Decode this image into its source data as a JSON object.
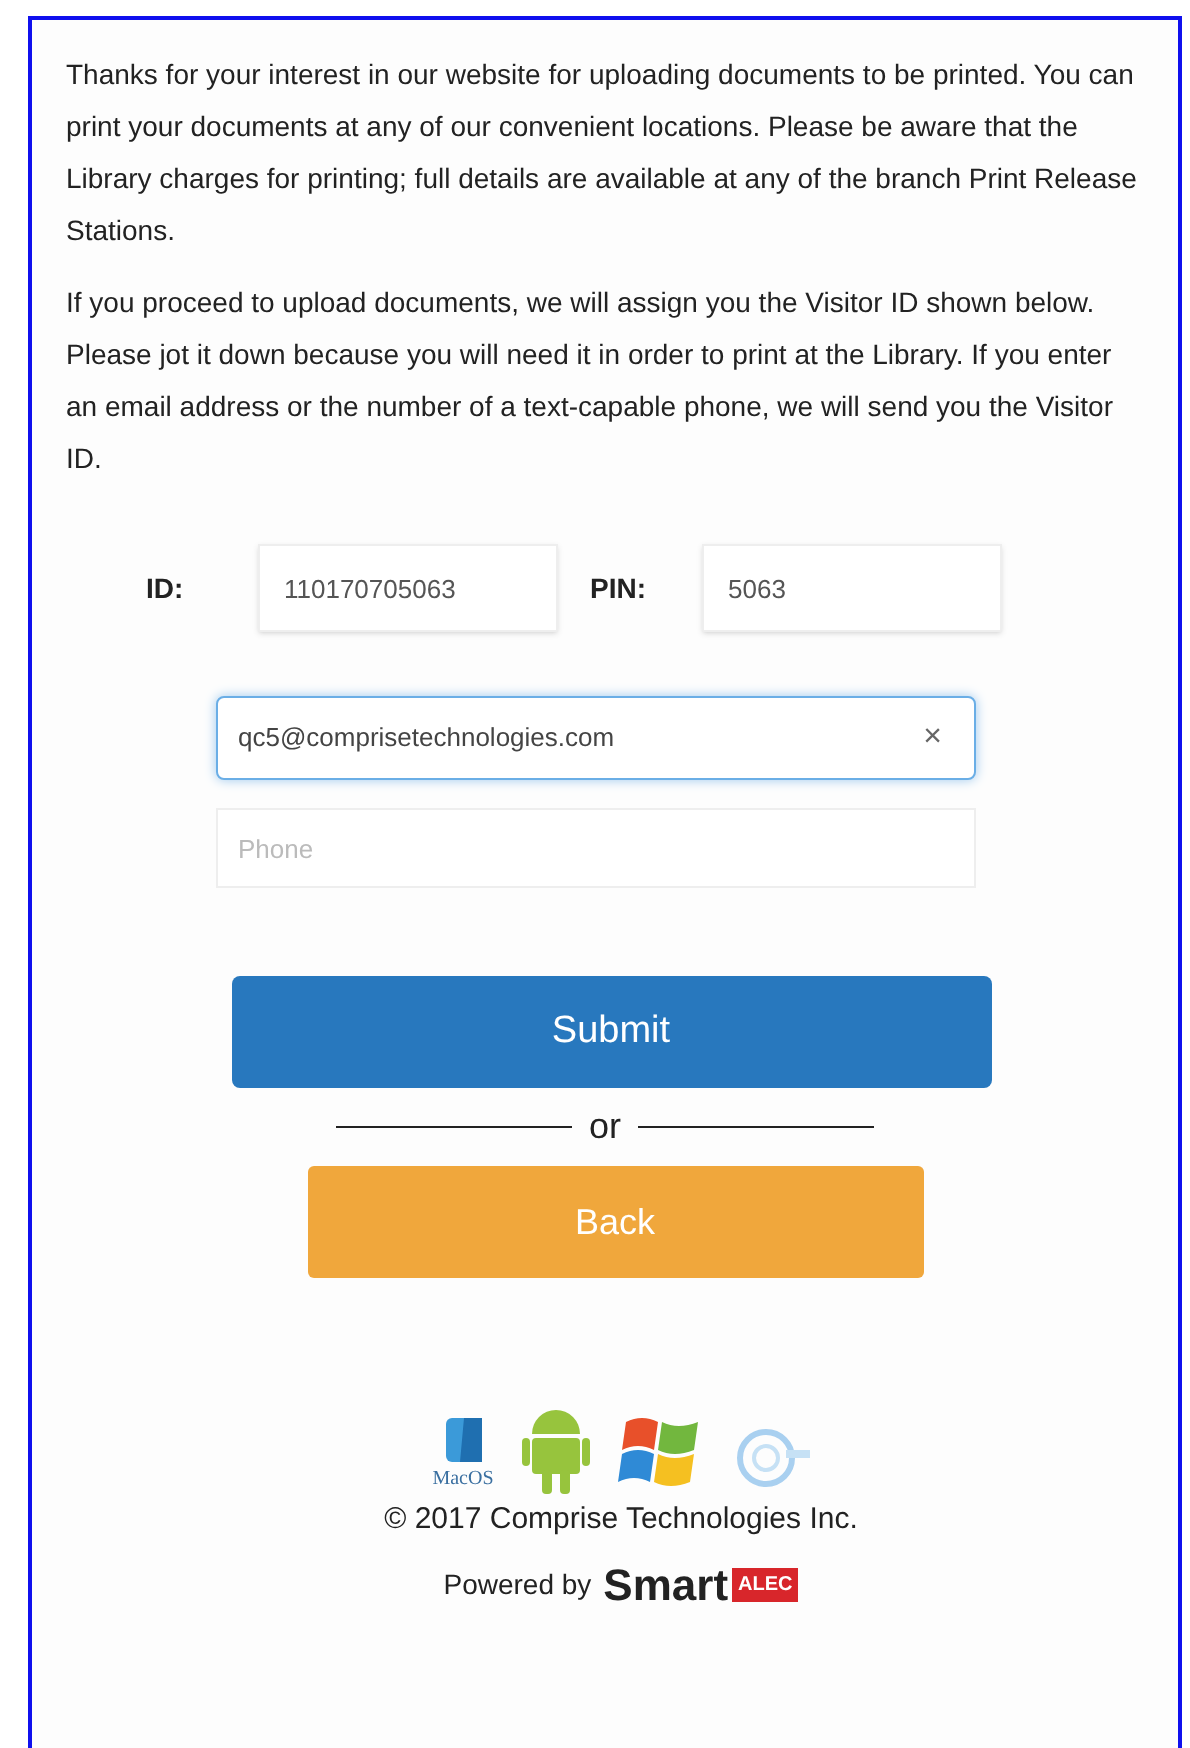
{
  "intro": [
    "Thanks for your interest in our website for uploading documents to be printed. You can print your documents at any of our convenient locations. Please be aware that the Library charges for printing; full details are available at any of the branch Print Release Stations.",
    "If you proceed to upload documents, we will assign you the Visitor ID shown below. Please jot it down because you will need it in order to print at the Library. If you enter an email address or the number of a text-capable phone, we will send you the Visitor ID."
  ],
  "credentials": [
    {
      "label": "ID:",
      "value": "110170705063"
    },
    {
      "label": "PIN:",
      "value": "5063"
    }
  ],
  "email": {
    "value": "qc5@comprisetechnologies.com",
    "focused": true,
    "clear": "×"
  },
  "phone": {
    "placeholder": "Phone"
  },
  "submit": "Submit",
  "separator": "or",
  "back": "Back",
  "platforms": {
    "mac_label": "MacOS"
  },
  "copyright": "© 2017 Comprise Technologies Inc.",
  "powered": {
    "prefix": "Powered by",
    "brand": "Smart",
    "badge": "ALEC"
  }
}
